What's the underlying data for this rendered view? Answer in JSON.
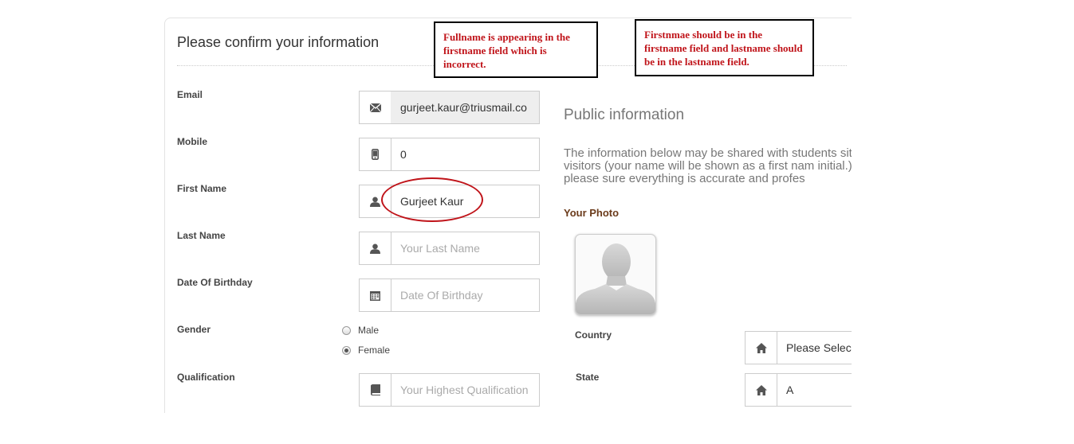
{
  "form": {
    "title": "Please confirm your information",
    "email_label": "Email",
    "email_value": "gurjeet.kaur@triusmail.co",
    "mobile_label": "Mobile",
    "mobile_value": "0",
    "first_name_label": "First Name",
    "first_name_value": "Gurjeet Kaur",
    "last_name_label": "Last Name",
    "last_name_placeholder": "Your Last Name",
    "dob_label": "Date Of Birthday",
    "dob_placeholder": "Date Of Birthday",
    "gender_label": "Gender",
    "gender_male": "Male",
    "gender_female": "Female",
    "gender_selected": "Female",
    "qualification_label": "Qualification",
    "qualification_placeholder": "Your Highest Qualification"
  },
  "public": {
    "title": "Public information",
    "description": "The information below may be shared with students site visitors (your name will be shown as a first nam initial.) please sure everything is accurate and profes",
    "photo_label": "Your Photo",
    "country_label": "Country",
    "country_value": "Please Selec",
    "state_label": "State",
    "state_value": "A"
  },
  "annotations": {
    "note_1": "Fullname is appearing in the firstname field which is incorrect.",
    "note_2": "Firstnmae should be in the firstname field and lastname should be in the lastname field.",
    "highlight_color": "#c0141a"
  },
  "icons": {
    "email": "envelope-icon",
    "mobile": "mobile-phone-icon",
    "first_name": "user-icon",
    "last_name": "user-icon",
    "dob": "calendar-icon",
    "qualification": "book-icon",
    "country": "home-icon",
    "state": "home-icon"
  }
}
